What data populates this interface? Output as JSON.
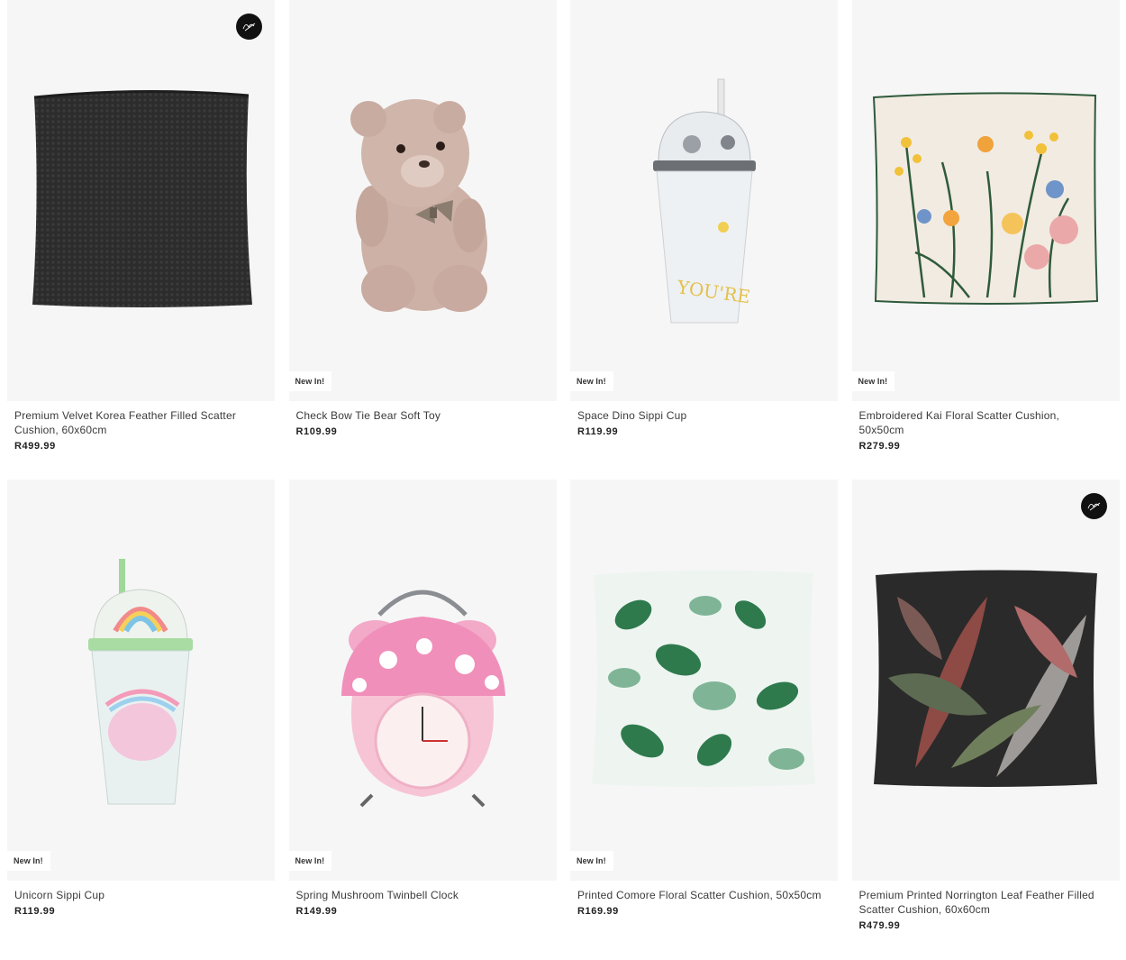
{
  "products": [
    {
      "name": "Premium Velvet Korea Feather Filled Scatter Cushion, 60x60cm",
      "price": "R499.99",
      "badge": "",
      "extra": true,
      "image": "black-velvet-cushion"
    },
    {
      "name": "Check Bow Tie Bear Soft Toy",
      "price": "R109.99",
      "badge": "New In!",
      "extra": false,
      "image": "teddy-bear"
    },
    {
      "name": "Space Dino Sippi Cup",
      "price": "R119.99",
      "badge": "New In!",
      "extra": false,
      "image": "dome-sippi-cup"
    },
    {
      "name": "Embroidered Kai Floral Scatter Cushion, 50x50cm",
      "price": "R279.99",
      "badge": "New In!",
      "extra": false,
      "image": "floral-embroidered-cushion"
    },
    {
      "name": "Unicorn Sippi Cup",
      "price": "R119.99",
      "badge": "New In!",
      "extra": false,
      "image": "unicorn-sippi-cup"
    },
    {
      "name": "Spring Mushroom Twinbell Clock",
      "price": "R149.99",
      "badge": "New In!",
      "extra": false,
      "image": "mushroom-alarm-clock"
    },
    {
      "name": "Printed Comore Floral Scatter Cushion, 50x50cm",
      "price": "R169.99",
      "badge": "New In!",
      "extra": false,
      "image": "green-floral-cushion"
    },
    {
      "name": "Premium Printed Norrington Leaf Feather Filled Scatter Cushion, 60x60cm",
      "price": "R479.99",
      "badge": "",
      "extra": true,
      "image": "leaf-print-cushion"
    }
  ],
  "colors": {
    "card_bg": "#f6f6f6",
    "badge_bg": "#ffffff",
    "extra_badge": "#111111"
  }
}
